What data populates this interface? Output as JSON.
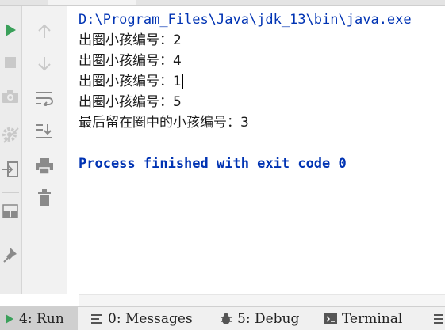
{
  "console": {
    "command": "D:\\Program_Files\\Java\\jdk_13\\bin\\java.exe",
    "output_lines": [
      "出圈小孩编号：2",
      "出圈小孩编号：4",
      "出圈小孩编号：1",
      "出圈小孩编号：5",
      "最后留在圈中的小孩编号：3"
    ],
    "exit_message": "Process finished with exit code 0"
  },
  "bottom_tabs": {
    "run": {
      "key": "4",
      "label": ": Run"
    },
    "messages": {
      "key": "0",
      "label": ": Messages"
    },
    "debug": {
      "key": "5",
      "label": ": Debug"
    },
    "terminal": {
      "label": "Terminal"
    }
  },
  "colors": {
    "accent_blue": "#0033b3",
    "run_green": "#3aa05a",
    "icon_gray": "#8a8a8a"
  },
  "icons": {
    "left_gutter": [
      "run-icon",
      "stop-icon",
      "camera-icon",
      "settings-disabled-icon",
      "exit-icon",
      "layout-icon",
      "pin-icon"
    ],
    "second_gutter": [
      "arrow-up-icon",
      "arrow-down-icon",
      "soft-wrap-icon",
      "scroll-to-end-icon",
      "print-icon",
      "trash-icon"
    ]
  }
}
